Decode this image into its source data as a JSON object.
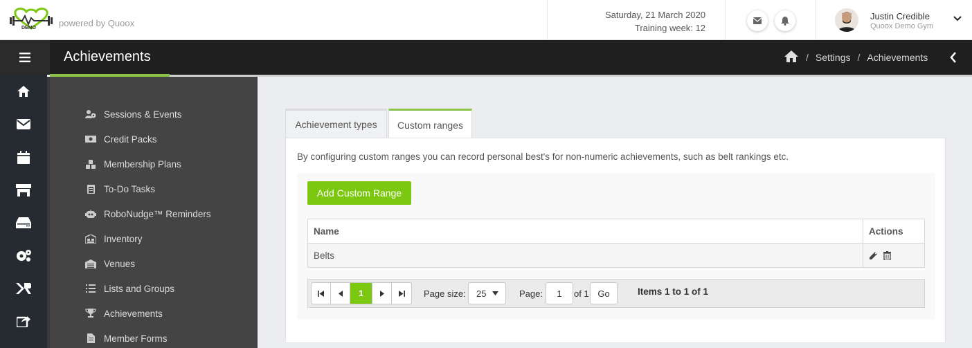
{
  "header": {
    "logo_text": "DEMO",
    "powered_by": "powered by Quoox",
    "date": "Saturday, 21 March 2020",
    "training_week": "Training week: 12",
    "mail_icon": "envelope-icon",
    "bell_icon": "bell-icon",
    "user_name": "Justin Credible",
    "user_gym": "Quoox Demo Gym"
  },
  "titlebar": {
    "title": "Achievements",
    "breadcrumb": [
      "Settings",
      "Achievements"
    ],
    "separator": "/"
  },
  "rail_icons": [
    "home-icon",
    "envelope-icon",
    "calendar-icon",
    "store-icon",
    "inbox-icon",
    "cogs-icon",
    "logo-r-icon",
    "share-icon"
  ],
  "menu": [
    {
      "label": "Sessions & Events",
      "icon": "users-cog-icon"
    },
    {
      "label": "Credit Packs",
      "icon": "money-icon"
    },
    {
      "label": "Membership Plans",
      "icon": "cubes-icon"
    },
    {
      "label": "To-Do Tasks",
      "icon": "clipboard-icon"
    },
    {
      "label": "RoboNudge™ Reminders",
      "icon": "robot-icon"
    },
    {
      "label": "Inventory",
      "icon": "warehouse-icon"
    },
    {
      "label": "Venues",
      "icon": "warehouse-icon"
    },
    {
      "label": "Lists and Groups",
      "icon": "list-icon"
    },
    {
      "label": "Achievements",
      "icon": "trophy-icon"
    },
    {
      "label": "Member Forms",
      "icon": "file-icon"
    }
  ],
  "tabs": [
    {
      "label": "Achievement types",
      "active": false
    },
    {
      "label": "Custom ranges",
      "active": true
    }
  ],
  "content": {
    "description": "By configuring custom ranges you can record personal best's for non-numeric achievements, such as belt rankings etc.",
    "add_button": "Add Custom Range",
    "columns": {
      "name": "Name",
      "actions": "Actions"
    },
    "rows": [
      {
        "name": "Belts"
      }
    ]
  },
  "pager": {
    "current_page": "1",
    "page_size_label": "Page size:",
    "page_size": "25",
    "page_label": "Page:",
    "page_value": "1",
    "of_label": "of 1",
    "go": "Go",
    "items_info": "Items 1 to 1 of 1"
  },
  "colors": {
    "accent": "#7cc70f",
    "dark": "#1f1f1f",
    "menu_bg": "#444444",
    "rail_bg": "#252b31"
  }
}
